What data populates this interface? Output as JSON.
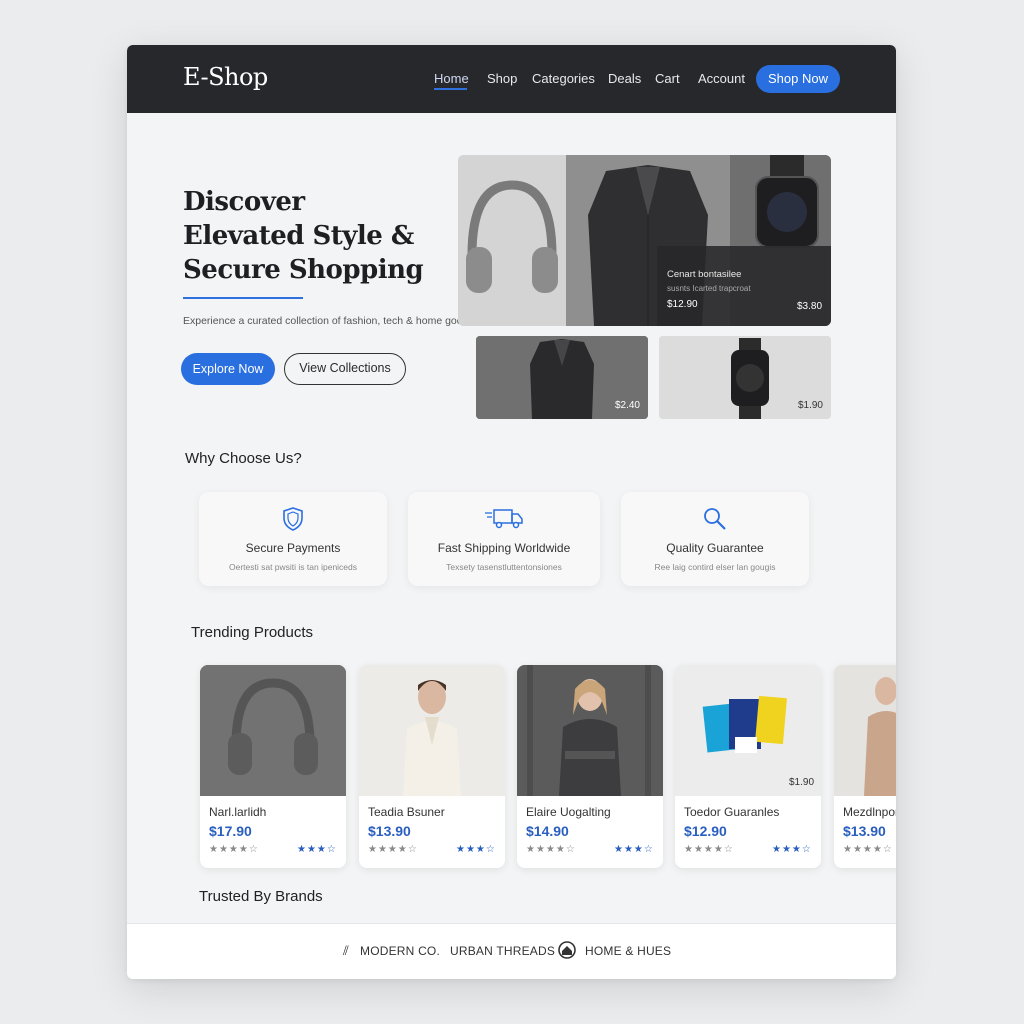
{
  "header": {
    "logo": "E-Shop",
    "nav": [
      "Home",
      "Shop",
      "Categories",
      "Deals",
      "Cart",
      "Account"
    ],
    "active": "Home",
    "cta": "Shop Now"
  },
  "hero": {
    "title_line1": "Discover",
    "title_line2": "Elevated Style &",
    "title_line3": "Secure Shopping",
    "subtitle": "Experience a curated collection of fashion, tech & home goods.",
    "primary_button": "Explore Now",
    "secondary_button": "View Collections",
    "overlay": {
      "title": "Cenart bontasilee",
      "subtitle": "susnts Icarted trapcroat",
      "price_left": "$12.90",
      "price_right": "$3.80"
    },
    "tile_prices": [
      "$2.40",
      "$1.90"
    ]
  },
  "why": {
    "title": "Why Choose Us?",
    "features": [
      {
        "icon": "shield-icon",
        "title": "Secure Payments",
        "desc": "Oertesti sat pwsiti is tan ipeniceds"
      },
      {
        "icon": "truck-icon",
        "title": "Fast Shipping Worldwide",
        "desc": "Texsety tasenstluttentonsiones"
      },
      {
        "icon": "magnifier-icon",
        "title": "Quality Guarantee",
        "desc": "Ree laig contird elser lan gougis"
      }
    ]
  },
  "trending": {
    "title": "Trending Products",
    "products": [
      {
        "name": "Narl.larlidh",
        "price": "$17.90",
        "badge": ""
      },
      {
        "name": "Teadia Bsuner",
        "price": "$13.90",
        "badge": ""
      },
      {
        "name": "Elaire Uogalting",
        "price": "$14.90",
        "badge": ""
      },
      {
        "name": "Toedor Guaranles",
        "price": "$12.90",
        "badge": "$1.90"
      },
      {
        "name": "Mezdlnpor",
        "price": "$13.90",
        "badge": ""
      }
    ],
    "stars_grey": "★★★★☆",
    "stars_blue": "★★★☆"
  },
  "brands": {
    "title": "Trusted By Brands",
    "items": [
      "MODERN CO.",
      "URBAN THREADS",
      "HOME & HUES"
    ]
  },
  "colors": {
    "accent": "#2a6fe0",
    "nav_bg": "#26282c",
    "price": "#2a5fbf"
  }
}
